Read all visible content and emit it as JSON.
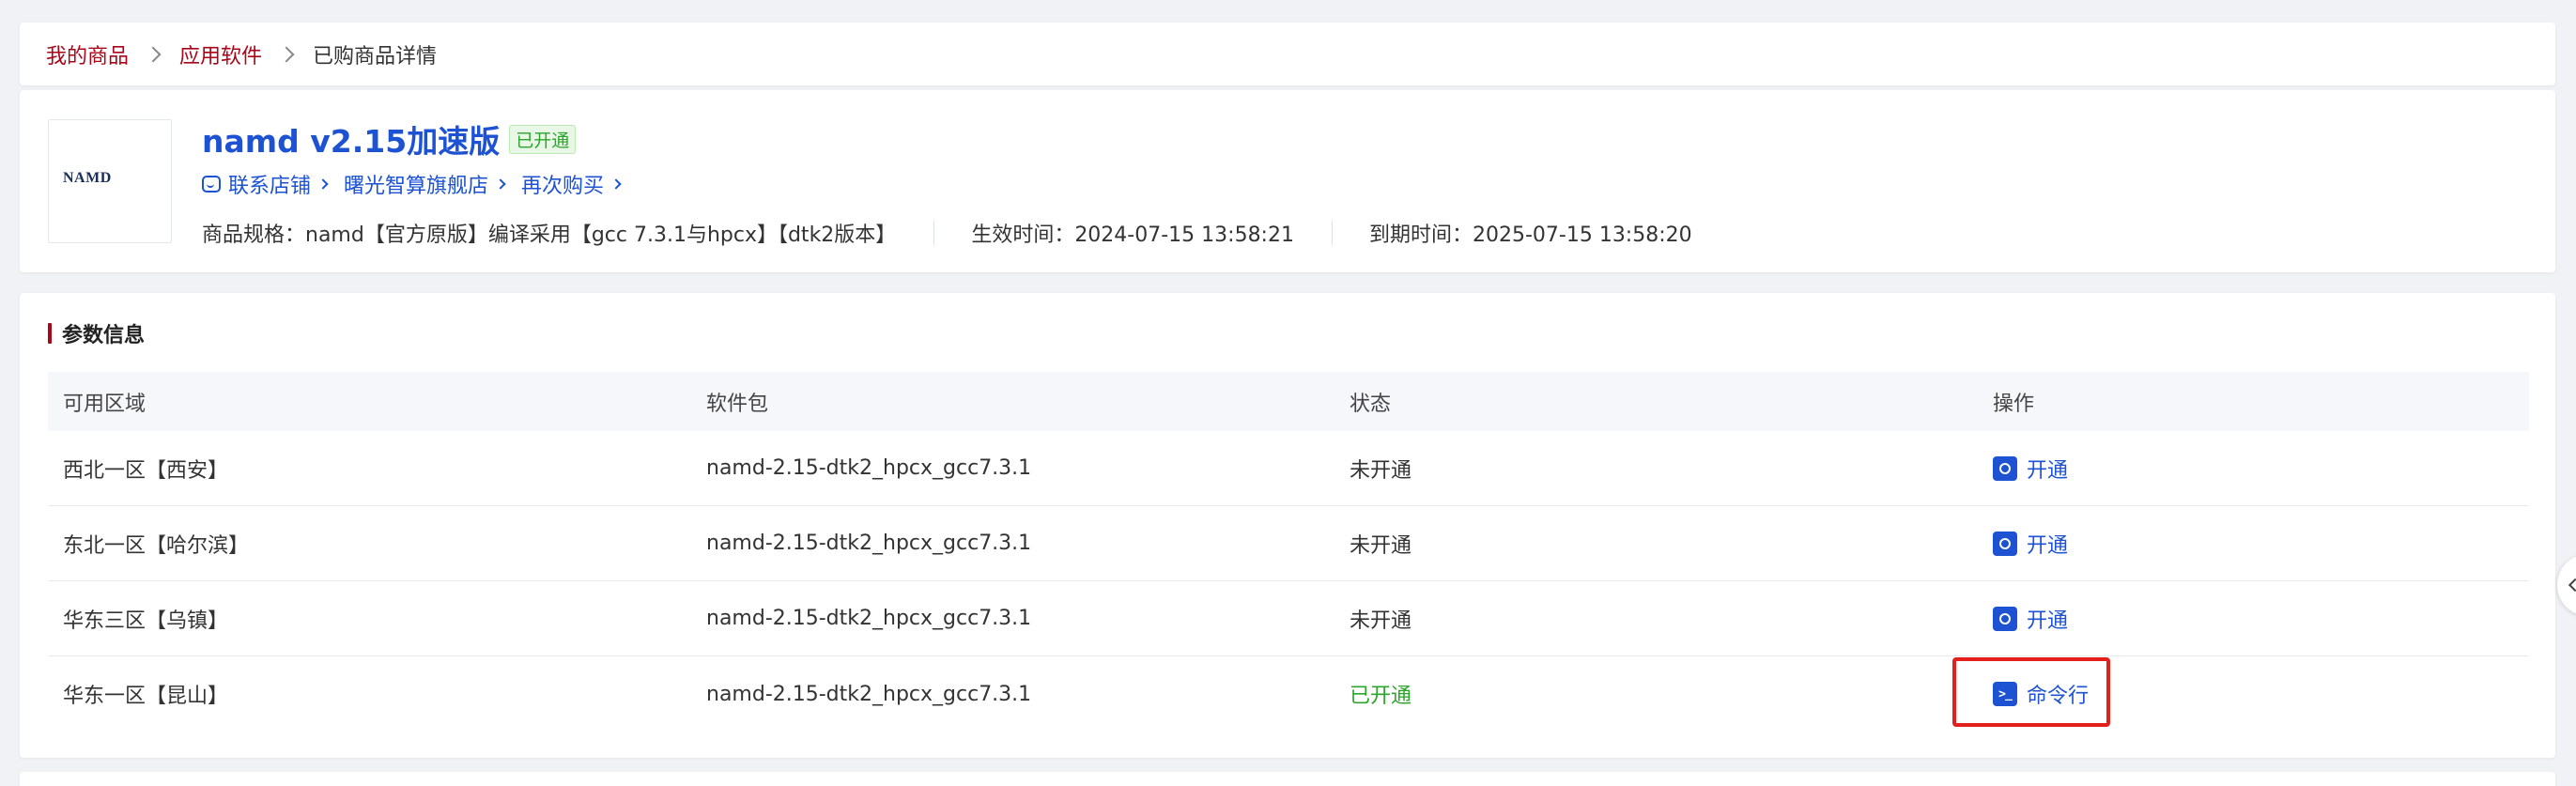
{
  "breadcrumb": {
    "items": [
      "我的商品",
      "应用软件"
    ],
    "current": "已购商品详情"
  },
  "product": {
    "title": "namd v2.15加速版",
    "status_badge": "已开通",
    "thumb_logo": "NAMD",
    "links": {
      "contact": "联系店铺",
      "store": "曙光智算旗舰店",
      "rebuy": "再次购买"
    },
    "spec": "商品规格：namd【官方原版】编译采用【gcc 7.3.1与hpcx】【dtk2版本】",
    "effective_time": "生效时间：2024-07-15 13:58:21",
    "expire_time": "到期时间：2025-07-15 13:58:20"
  },
  "params": {
    "section_title": "参数信息",
    "columns": [
      "可用区域",
      "软件包",
      "状态",
      "操作"
    ],
    "rows": [
      {
        "region": "西北一区【西安】",
        "package": "namd-2.15-dtk2_hpcx_gcc7.3.1",
        "status": "未开通",
        "action": "开通",
        "action_icon": "key-icon"
      },
      {
        "region": "东北一区【哈尔滨】",
        "package": "namd-2.15-dtk2_hpcx_gcc7.3.1",
        "status": "未开通",
        "action": "开通",
        "action_icon": "key-icon"
      },
      {
        "region": "华东三区【乌镇】",
        "package": "namd-2.15-dtk2_hpcx_gcc7.3.1",
        "status": "未开通",
        "action": "开通",
        "action_icon": "key-icon"
      },
      {
        "region": "华东一区【昆山】",
        "package": "namd-2.15-dtk2_hpcx_gcc7.3.1",
        "status": "已开通",
        "action": "命令行",
        "action_icon": "terminal-icon"
      }
    ]
  },
  "colors": {
    "accent": "#1d52d3",
    "brand_red": "#a8071a",
    "status_on": "#2ba52b",
    "highlight": "#e3201b"
  }
}
